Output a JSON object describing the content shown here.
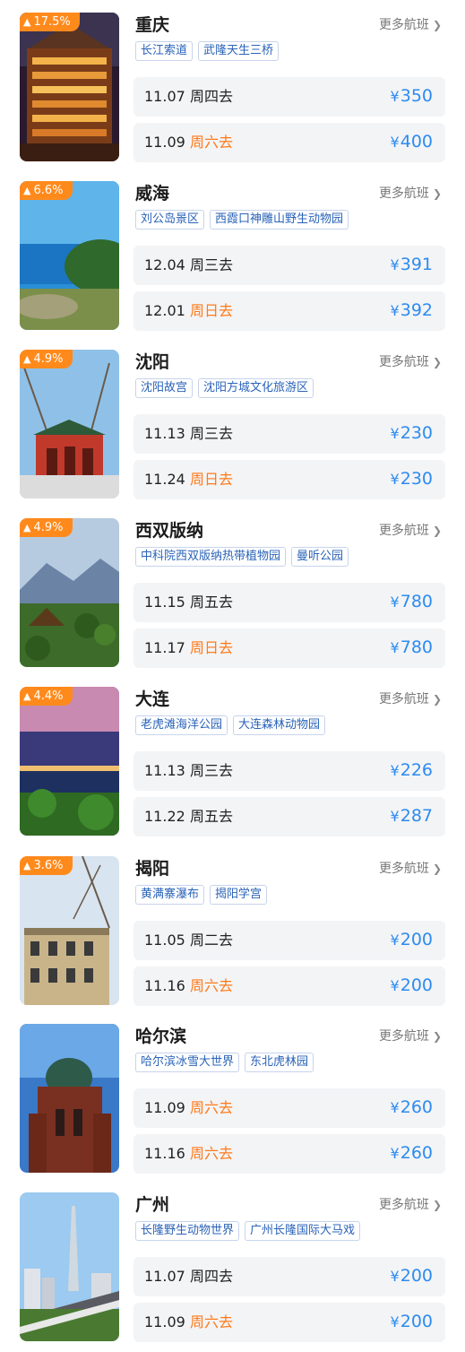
{
  "more_label": "更多航班",
  "currency": "¥",
  "colors": {
    "accent_blue": "#2d8bf0",
    "weekend_orange": "#ff7a1a",
    "badge_orange": "#ff8a1c",
    "tag_blue": "#2a63b8"
  },
  "destinations": [
    {
      "heat": "17.5%",
      "city": "重庆",
      "tags": [
        "长江索道",
        "武隆天生三桥"
      ],
      "image": "chongqing-hongyadong-night",
      "flights": [
        {
          "date": "11.07",
          "weekday": "周四去",
          "weekend": false,
          "price": "350"
        },
        {
          "date": "11.09",
          "weekday": "周六去",
          "weekend": true,
          "price": "400"
        }
      ]
    },
    {
      "heat": "6.6%",
      "city": "威海",
      "tags": [
        "刘公岛景区",
        "西霞口神雕山野生动物园"
      ],
      "image": "weihai-coast",
      "flights": [
        {
          "date": "12.04",
          "weekday": "周三去",
          "weekend": false,
          "price": "391"
        },
        {
          "date": "12.01",
          "weekday": "周日去",
          "weekend": true,
          "price": "392"
        }
      ]
    },
    {
      "heat": "4.9%",
      "city": "沈阳",
      "tags": [
        "沈阳故宫",
        "沈阳方城文化旅游区"
      ],
      "image": "shenyang-palace-gate",
      "flights": [
        {
          "date": "11.13",
          "weekday": "周三去",
          "weekend": false,
          "price": "230"
        },
        {
          "date": "11.24",
          "weekday": "周日去",
          "weekend": true,
          "price": "230"
        }
      ]
    },
    {
      "heat": "4.9%",
      "city": "西双版纳",
      "tags": [
        "中科院西双版纳热带植物园",
        "曼听公园"
      ],
      "image": "xishuangbanna-mountains",
      "flights": [
        {
          "date": "11.15",
          "weekday": "周五去",
          "weekend": false,
          "price": "780"
        },
        {
          "date": "11.17",
          "weekday": "周日去",
          "weekend": true,
          "price": "780"
        }
      ]
    },
    {
      "heat": "4.4%",
      "city": "大连",
      "tags": [
        "老虎滩海洋公园",
        "大连森林动物园"
      ],
      "image": "dalian-bay-dusk",
      "flights": [
        {
          "date": "11.13",
          "weekday": "周三去",
          "weekend": false,
          "price": "226"
        },
        {
          "date": "11.22",
          "weekday": "周五去",
          "weekend": false,
          "price": "287"
        }
      ]
    },
    {
      "heat": "3.6%",
      "city": "揭阳",
      "tags": [
        "黄满寨瀑布",
        "揭阳学宫"
      ],
      "image": "jieyang-old-building",
      "flights": [
        {
          "date": "11.05",
          "weekday": "周二去",
          "weekend": false,
          "price": "200"
        },
        {
          "date": "11.16",
          "weekday": "周六去",
          "weekend": true,
          "price": "200"
        }
      ]
    },
    {
      "heat": "",
      "city": "哈尔滨",
      "tags": [
        "哈尔滨冰雪大世界",
        "东北虎林园"
      ],
      "image": "harbin-sophia-cathedral",
      "flights": [
        {
          "date": "11.09",
          "weekday": "周六去",
          "weekend": true,
          "price": "260"
        },
        {
          "date": "11.16",
          "weekday": "周六去",
          "weekend": true,
          "price": "260"
        }
      ]
    },
    {
      "heat": "",
      "city": "广州",
      "tags": [
        "长隆野生动物世界",
        "广州长隆国际大马戏"
      ],
      "image": "guangzhou-canton-tower",
      "flights": [
        {
          "date": "11.07",
          "weekday": "周四去",
          "weekend": false,
          "price": "200"
        },
        {
          "date": "11.09",
          "weekday": "周六去",
          "weekend": true,
          "price": "200"
        }
      ]
    }
  ]
}
